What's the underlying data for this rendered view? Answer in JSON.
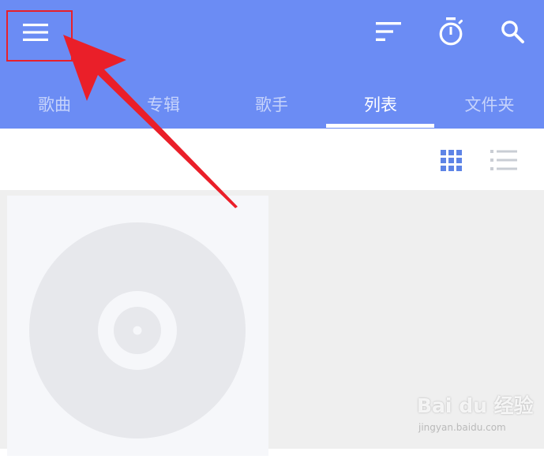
{
  "header": {
    "icons": [
      "menu-icon",
      "sort-icon",
      "timer-icon",
      "search-icon"
    ],
    "background_color": "#6b8cf4"
  },
  "tabs": [
    {
      "label": "歌曲",
      "active": false
    },
    {
      "label": "专辑",
      "active": false
    },
    {
      "label": "歌手",
      "active": false
    },
    {
      "label": "列表",
      "active": true
    },
    {
      "label": "文件夹",
      "active": false
    }
  ],
  "toolbar": {
    "grid_view": {
      "icon": "grid-view-icon",
      "selected": true
    },
    "list_view": {
      "icon": "list-view-icon",
      "selected": false
    }
  },
  "content": {
    "items": [
      {
        "cover": "disc-placeholder-icon"
      }
    ]
  },
  "annotation": {
    "highlight_color": "#e8202a",
    "target": "menu-button"
  },
  "watermark": {
    "main": "Bai du 经验",
    "sub": "jingyan.baidu.com"
  }
}
